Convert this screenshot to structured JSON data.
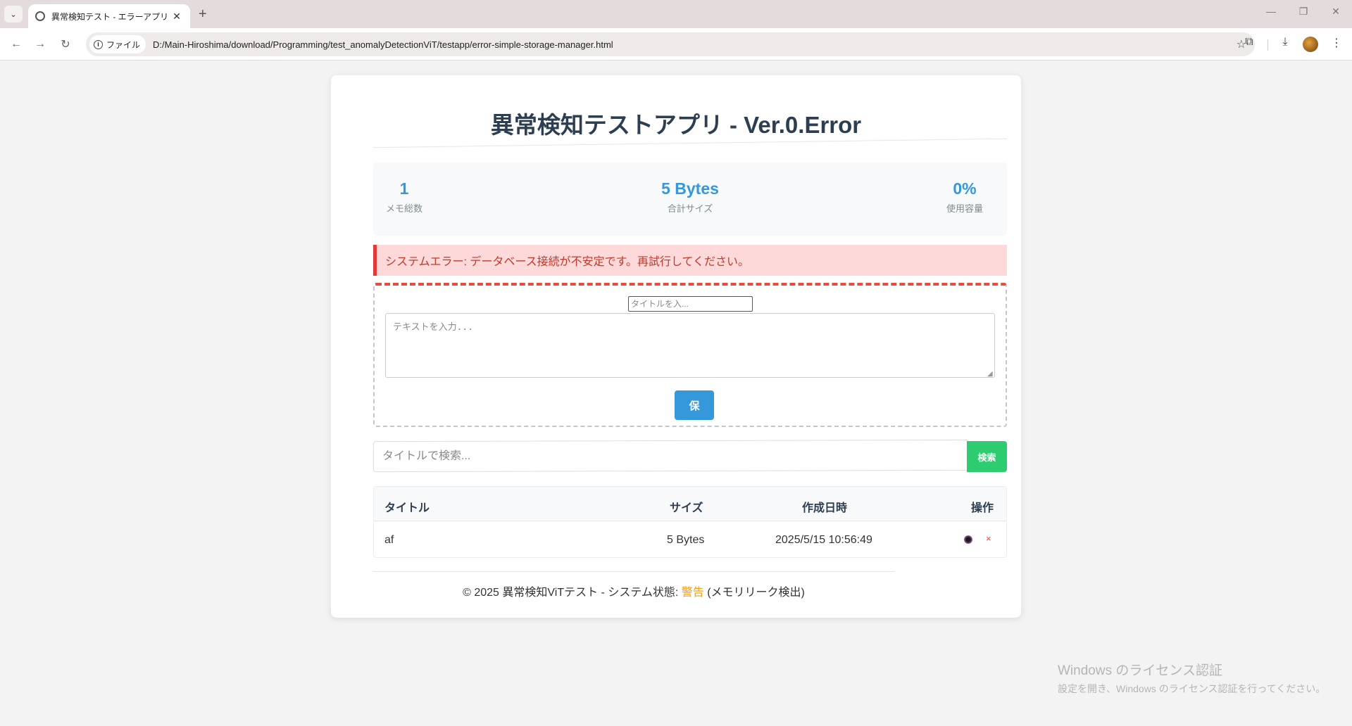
{
  "browser": {
    "tab_title": "異常検知テスト - エラーアプリ",
    "chip_label": "ファイル",
    "url": "D:/Main-Hiroshima/download/Programming/test_anomalyDetectionViT/testapp/error-simple-storage-manager.html"
  },
  "app": {
    "title": "異常検知テストアプリ - Ver.0.Error",
    "stats": [
      {
        "value": "1",
        "label": "メモ総数"
      },
      {
        "value": "5 Bytes",
        "label": "合計サイズ"
      },
      {
        "value": "0%",
        "label": "使用容量"
      }
    ],
    "error_message": "システムエラー: データベース接続が不安定です。再試行してください。",
    "form": {
      "title_placeholder": "タイトルを入...",
      "text_placeholder": "テキストを入力...",
      "save_label": "保"
    },
    "search": {
      "placeholder": "タイトルで検索...",
      "button_label": "検索"
    },
    "table": {
      "headers": [
        "タイトル",
        "サイズ",
        "作成日時",
        "操作"
      ],
      "rows": [
        {
          "title": "af",
          "size": "5 Bytes",
          "created": "2025/5/15 10:56:49"
        }
      ]
    },
    "footer": {
      "prefix": "© 2025 異常検知ViTテスト - システム状態: ",
      "status": "警告",
      "suffix": " (メモリリーク検出)"
    }
  },
  "watermark": {
    "title": "Windows のライセンス認証",
    "subtitle": "設定を開き、Windows のライセンス認証を行ってください。"
  },
  "colors": {
    "accent": "#3498db",
    "success": "#2ecc71",
    "error": "#e74c3c",
    "warning": "#f39c12"
  }
}
